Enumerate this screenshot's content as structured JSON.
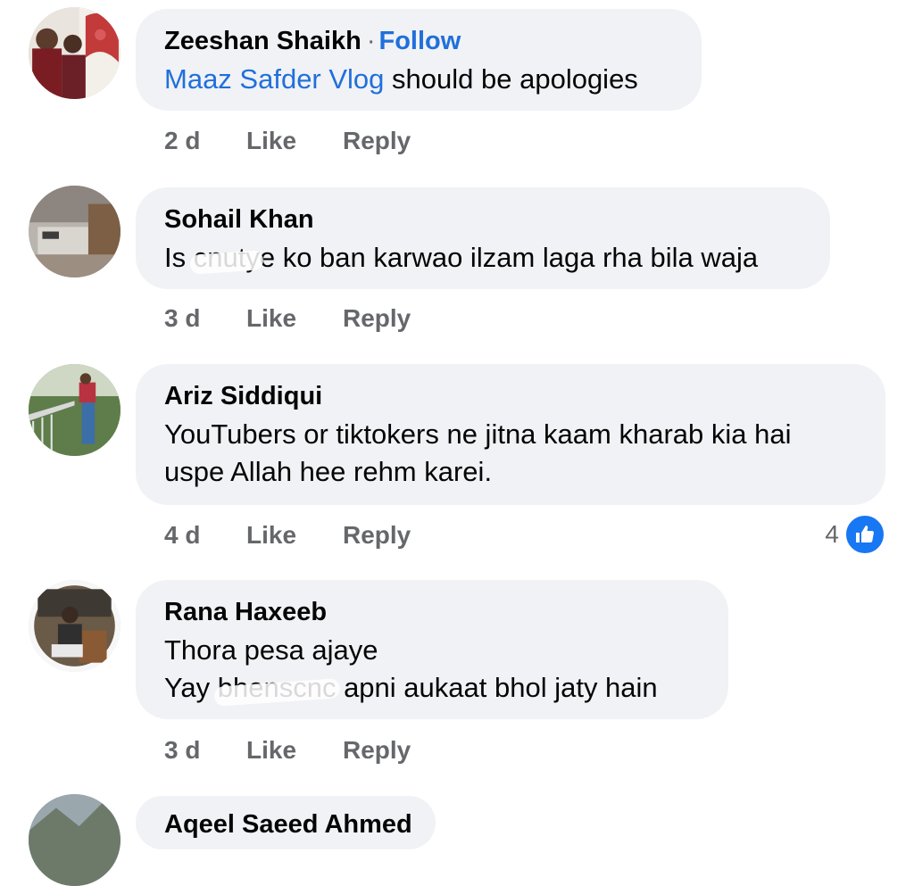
{
  "comments": [
    {
      "name": "Zeeshan Shaikh",
      "separator": "·",
      "follow": "Follow",
      "mention": "Maaz Safder Vlog",
      "text": " should be apologies",
      "time": "2 d",
      "like": "Like",
      "reply": "Reply"
    },
    {
      "name": "Sohail Khan",
      "text_pre": "Is ",
      "text_blur": "cnuty",
      "text_post": "e ko ban karwao ilzam laga rha bila waja",
      "time": "3 d",
      "like": "Like",
      "reply": "Reply"
    },
    {
      "name": "Ariz Siddiqui",
      "line1": "YouTubers or tiktokers ne jitna kaam kharab kia hai",
      "line2": "uspe Allah hee rehm karei.",
      "time": "4 d",
      "like": "Like",
      "reply": "Reply",
      "reaction_count": "4",
      "reaction_icon": "thumbs-up-icon"
    },
    {
      "name": "Rana Haxeeb",
      "line1": "Thora pesa ajaye",
      "line2_pre": "Yay ",
      "line2_blur": "bhenscnc",
      "line2_post": " apni aukaat bhol jaty hain",
      "time": "3 d",
      "like": "Like",
      "reply": "Reply"
    },
    {
      "name": "Aqeel Saeed Ahmed"
    }
  ],
  "colors": {
    "bubble": "#f0f2f5",
    "link": "#216fdb",
    "meta": "#65676b",
    "like_badge": "#1877f2"
  }
}
